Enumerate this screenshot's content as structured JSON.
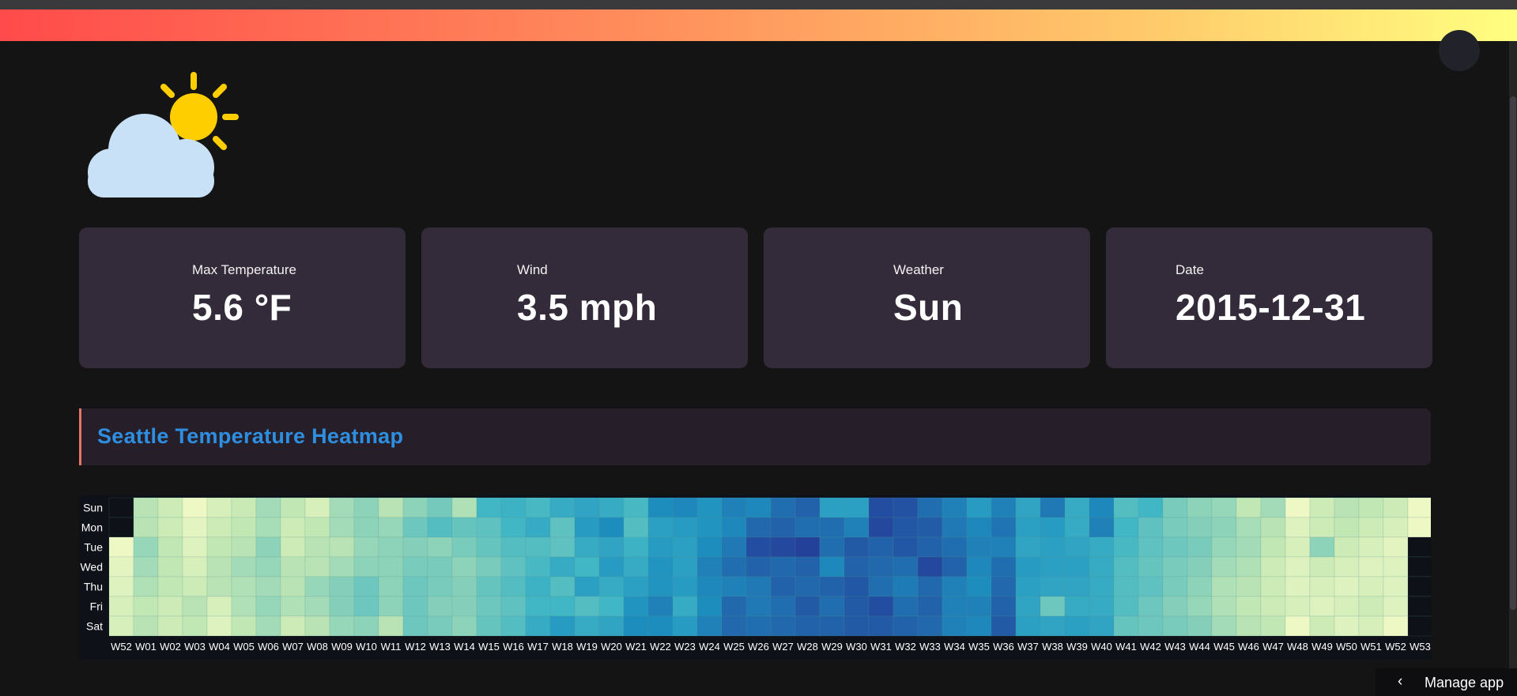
{
  "header": {
    "accent_gradient": [
      "#ff4b4b",
      "#ffff80"
    ]
  },
  "weather_icon": {
    "name": "partly-sunny-icon",
    "sun_color": "#ffce00",
    "cloud_color": "#c9e1f7"
  },
  "metrics": [
    {
      "label": "Max Temperature",
      "value": "5.6 °F"
    },
    {
      "label": "Wind",
      "value": "3.5 mph"
    },
    {
      "label": "Weather",
      "value": "Sun"
    },
    {
      "label": "Date",
      "value": "2015-12-31"
    }
  ],
  "section": {
    "title": "Seattle Temperature Heatmap",
    "title_color": "#2e8ee0",
    "border_color": "#e8756a"
  },
  "chart_data": {
    "type": "heatmap",
    "y_categories": [
      "Sun",
      "Mon",
      "Tue",
      "Wed",
      "Thu",
      "Fri",
      "Sat"
    ],
    "x_categories": [
      "W52",
      "W01",
      "W02",
      "W03",
      "W04",
      "W05",
      "W06",
      "W07",
      "W08",
      "W09",
      "W10",
      "W11",
      "W12",
      "W13",
      "W14",
      "W15",
      "W16",
      "W17",
      "W18",
      "W19",
      "W20",
      "W21",
      "W22",
      "W23",
      "W24",
      "W25",
      "W26",
      "W27",
      "W28",
      "W29",
      "W30",
      "W31",
      "W32",
      "W33",
      "W34",
      "W35",
      "W36",
      "W37",
      "W38",
      "W39",
      "W40",
      "W41",
      "W42",
      "W43",
      "W44",
      "W45",
      "W46",
      "W47",
      "W48",
      "W49",
      "W50",
      "W51",
      "W52",
      "W53"
    ],
    "colorscale": [
      "#ffffcc",
      "#c7e9b4",
      "#7fcdbb",
      "#41b6c4",
      "#1d91c0",
      "#225ea8",
      "#253494"
    ],
    "values_0_to_1": [
      [
        null,
        0.2,
        0.15,
        0.05,
        0.12,
        0.16,
        0.25,
        0.18,
        0.12,
        0.25,
        0.3,
        0.2,
        0.3,
        0.36,
        0.22,
        0.5,
        0.52,
        0.48,
        0.55,
        0.58,
        0.55,
        0.48,
        0.68,
        0.7,
        0.65,
        0.72,
        0.7,
        0.78,
        0.82,
        0.6,
        0.6,
        0.9,
        0.88,
        0.78,
        0.72,
        0.62,
        0.72,
        0.58,
        0.75,
        0.55,
        0.7,
        0.45,
        0.5,
        0.35,
        0.3,
        0.28,
        0.18,
        0.25,
        0.05,
        0.15,
        0.2,
        0.18,
        0.15,
        0.05
      ],
      [
        null,
        0.2,
        0.15,
        0.08,
        0.15,
        0.18,
        0.24,
        0.15,
        0.18,
        0.25,
        0.3,
        0.28,
        0.38,
        0.45,
        0.4,
        0.42,
        0.5,
        0.55,
        0.42,
        0.62,
        0.68,
        0.45,
        0.6,
        0.62,
        0.65,
        0.7,
        0.8,
        0.82,
        0.78,
        0.78,
        0.72,
        0.92,
        0.86,
        0.84,
        0.75,
        0.7,
        0.76,
        0.6,
        0.62,
        0.55,
        0.72,
        0.5,
        0.42,
        0.35,
        0.32,
        0.3,
        0.24,
        0.2,
        0.1,
        0.15,
        0.18,
        0.15,
        0.12,
        0.05
      ],
      [
        0.05,
        0.28,
        0.18,
        0.1,
        0.18,
        0.2,
        0.3,
        0.15,
        0.2,
        0.2,
        0.28,
        0.3,
        0.32,
        0.3,
        0.35,
        0.4,
        0.45,
        0.45,
        0.42,
        0.55,
        0.58,
        0.52,
        0.62,
        0.6,
        0.68,
        0.75,
        0.9,
        0.92,
        0.95,
        0.78,
        0.85,
        0.82,
        0.86,
        0.82,
        0.78,
        0.72,
        0.72,
        0.58,
        0.6,
        0.58,
        0.55,
        0.48,
        0.42,
        0.38,
        0.35,
        0.28,
        0.25,
        0.18,
        0.12,
        0.3,
        0.15,
        0.12,
        0.08,
        null
      ],
      [
        0.08,
        0.25,
        0.18,
        0.12,
        0.2,
        0.25,
        0.28,
        0.2,
        0.2,
        0.25,
        0.3,
        0.3,
        0.35,
        0.35,
        0.3,
        0.35,
        0.42,
        0.48,
        0.55,
        0.5,
        0.62,
        0.55,
        0.65,
        0.6,
        0.72,
        0.78,
        0.82,
        0.8,
        0.82,
        0.7,
        0.82,
        0.8,
        0.78,
        0.92,
        0.82,
        0.7,
        0.78,
        0.62,
        0.6,
        0.6,
        0.55,
        0.45,
        0.4,
        0.35,
        0.32,
        0.25,
        0.22,
        0.15,
        0.1,
        0.15,
        0.12,
        0.1,
        0.1,
        null
      ],
      [
        0.1,
        0.22,
        0.18,
        0.15,
        0.2,
        0.22,
        0.25,
        0.2,
        0.28,
        0.32,
        0.38,
        0.3,
        0.38,
        0.35,
        0.32,
        0.4,
        0.45,
        0.52,
        0.45,
        0.6,
        0.55,
        0.6,
        0.65,
        0.62,
        0.7,
        0.72,
        0.75,
        0.82,
        0.8,
        0.82,
        0.86,
        0.78,
        0.74,
        0.8,
        0.72,
        0.68,
        0.8,
        0.6,
        0.58,
        0.58,
        0.55,
        0.45,
        0.42,
        0.35,
        0.3,
        0.22,
        0.2,
        0.15,
        0.1,
        0.12,
        0.1,
        0.12,
        0.1,
        null
      ],
      [
        0.12,
        0.18,
        0.15,
        0.2,
        0.12,
        0.22,
        0.28,
        0.22,
        0.25,
        0.32,
        0.38,
        0.3,
        0.38,
        0.32,
        0.32,
        0.38,
        0.42,
        0.5,
        0.5,
        0.45,
        0.5,
        0.65,
        0.72,
        0.55,
        0.68,
        0.8,
        0.75,
        0.78,
        0.85,
        0.78,
        0.85,
        0.9,
        0.78,
        0.82,
        0.72,
        0.72,
        0.82,
        0.58,
        0.38,
        0.55,
        0.55,
        0.45,
        0.38,
        0.32,
        0.28,
        0.22,
        0.18,
        0.15,
        0.12,
        0.1,
        0.12,
        0.15,
        0.1,
        null
      ],
      [
        0.12,
        0.2,
        0.15,
        0.18,
        0.1,
        0.18,
        0.25,
        0.15,
        0.2,
        0.28,
        0.3,
        0.2,
        0.38,
        0.35,
        0.3,
        0.4,
        0.45,
        0.55,
        0.62,
        0.55,
        0.58,
        0.68,
        0.68,
        0.62,
        0.72,
        0.8,
        0.78,
        0.8,
        0.82,
        0.82,
        0.85,
        0.85,
        0.82,
        0.8,
        0.72,
        0.7,
        0.85,
        0.6,
        0.58,
        0.6,
        0.58,
        0.4,
        0.38,
        0.35,
        0.32,
        0.25,
        0.2,
        0.18,
        0.05,
        0.15,
        0.1,
        0.12,
        0.05,
        null
      ]
    ]
  },
  "manage_app": {
    "label": "Manage app",
    "icon": "chevron-left-icon"
  }
}
